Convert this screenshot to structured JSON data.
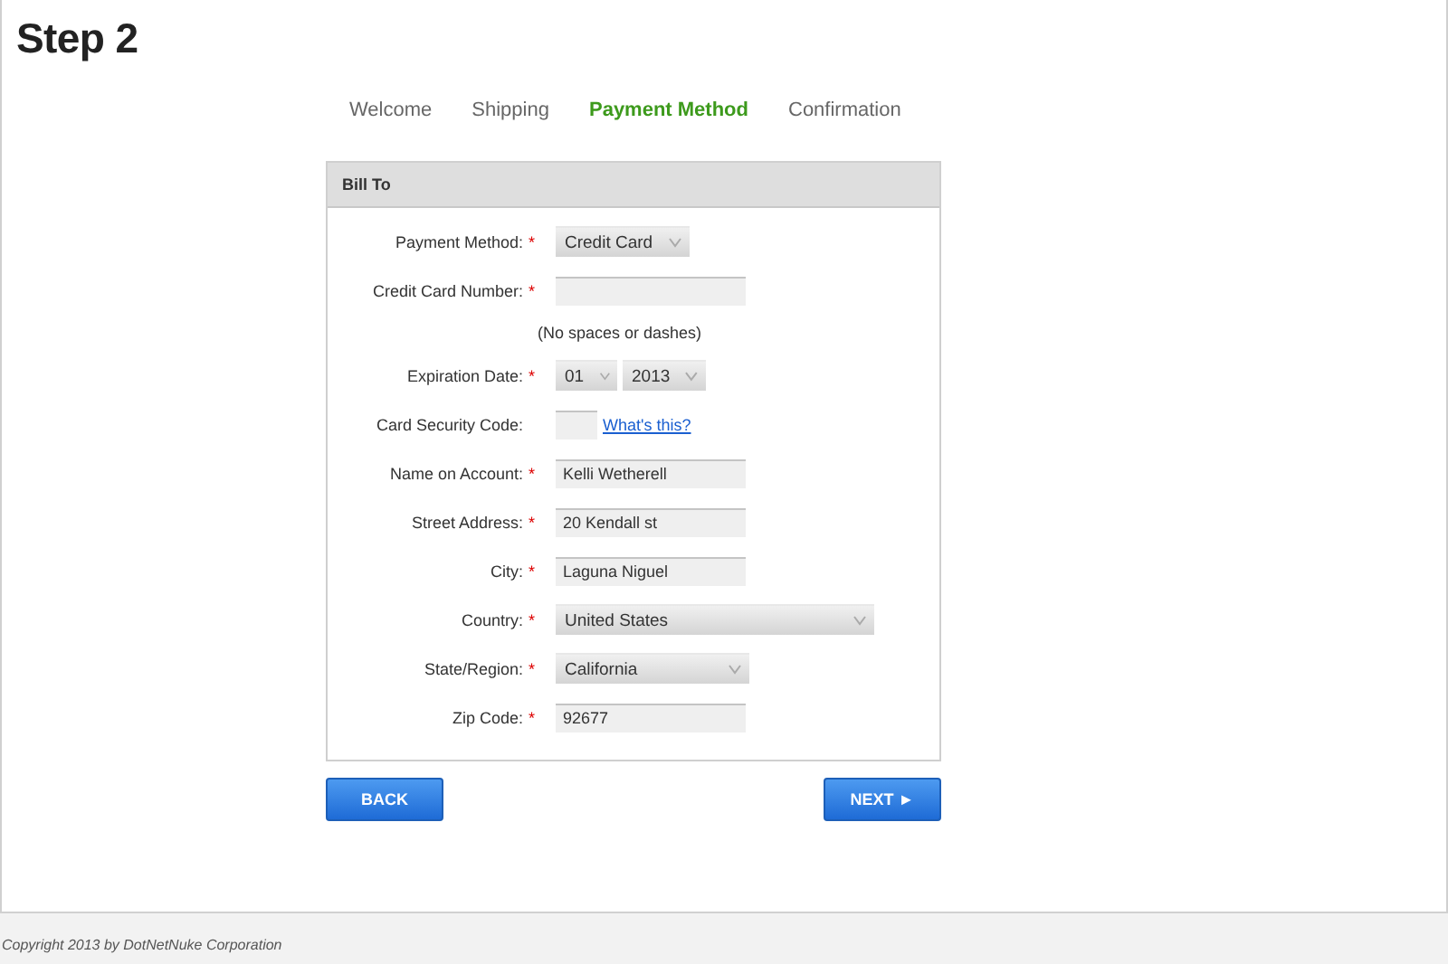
{
  "heading": "Step 2",
  "steps": [
    {
      "label": "Welcome",
      "selected": false
    },
    {
      "label": "Shipping",
      "selected": false
    },
    {
      "label": "Payment Method",
      "selected": true
    },
    {
      "label": "Confirmation",
      "selected": false
    }
  ],
  "form": {
    "title": "Bill To",
    "fields": [
      {
        "kind": "select",
        "label": "Payment Method:",
        "marker": "*",
        "value": "Credit Card"
      },
      {
        "kind": "text",
        "label": "Credit Card Number:",
        "marker": "*"
      },
      {
        "kind": "hint",
        "text": "(No spaces or dashes)"
      },
      {
        "kind": "date",
        "label": "Expiration Date:",
        "marker": "*",
        "values": [
          "01",
          "2013"
        ]
      },
      {
        "kind": "code",
        "label": "Card Security Code:",
        "link": "What's this?"
      },
      {
        "kind": "text",
        "label": "Name on Account:",
        "marker": "*",
        "value": "Kelli Wetherell"
      },
      {
        "kind": "text",
        "label": "Street Address:",
        "marker": "*",
        "value": "20 Kendall st"
      },
      {
        "kind": "text",
        "label": "City:",
        "marker": "*",
        "value": "Laguna Niguel"
      },
      {
        "kind": "country",
        "label": "Country:",
        "marker": "*",
        "value": "United States"
      },
      {
        "kind": "region",
        "label": "State/Region:",
        "marker": "*",
        "value": "California"
      },
      {
        "kind": "text",
        "label": "Zip Code:",
        "marker": "*",
        "value": "92677"
      }
    ]
  },
  "buttons": {
    "back": "BACK",
    "next": "NEXT ►"
  },
  "footer": "Copyright 2013 by DotNetNuke Corporation"
}
